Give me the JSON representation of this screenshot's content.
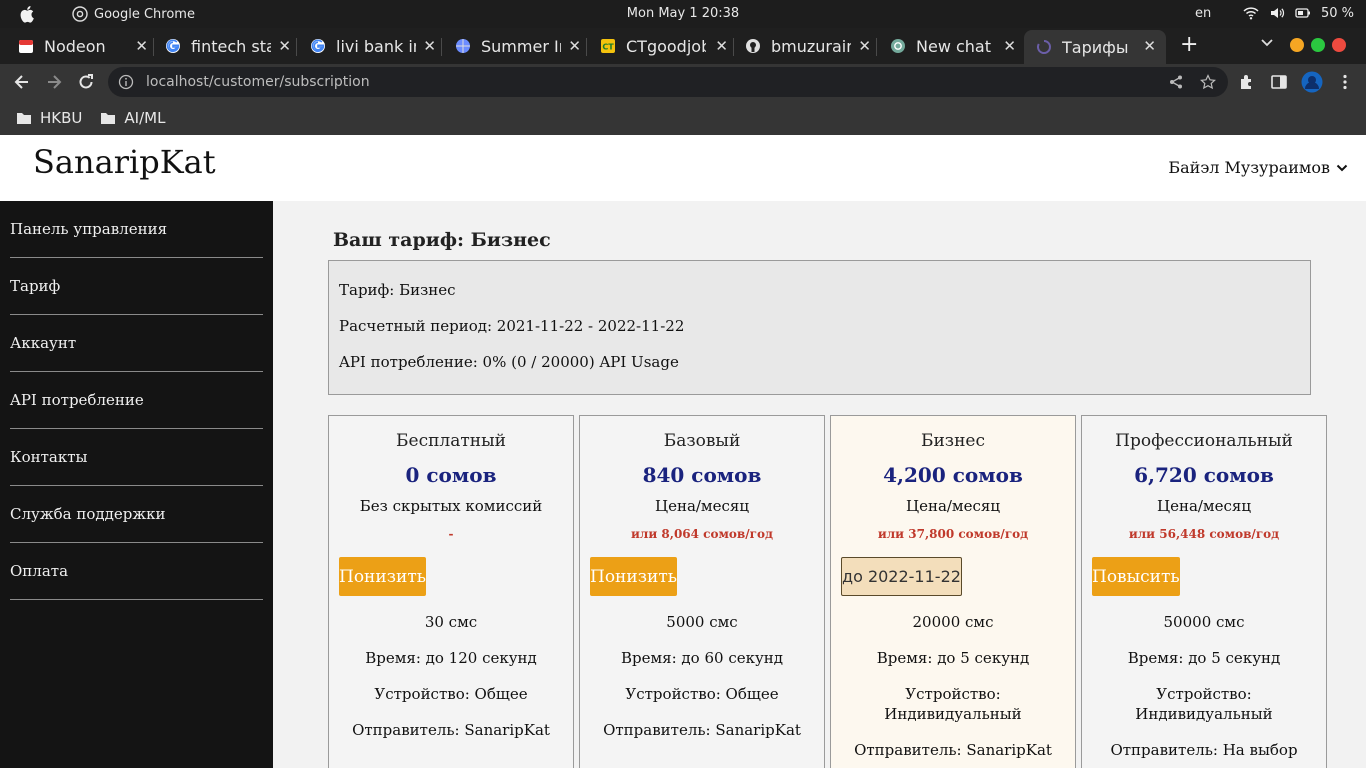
{
  "os": {
    "app_name": "Google Chrome",
    "clock": "Mon May 1  20:38",
    "lang": "en",
    "battery": "50 %"
  },
  "tabs": [
    {
      "title": "Nodeon",
      "icon": "calendar-icon",
      "color": "#e53935"
    },
    {
      "title": "fintech star",
      "icon": "google-icon",
      "color": "#4285f4"
    },
    {
      "title": "livi bank int",
      "icon": "google-icon",
      "color": "#4285f4"
    },
    {
      "title": "Summer In",
      "icon": "globe-icon",
      "color": "#6b8cff"
    },
    {
      "title": "CTgoodjobs",
      "icon": "ctgoodjobs-icon",
      "color": "#f4c20d"
    },
    {
      "title": "bmuzuraim",
      "icon": "github-icon",
      "color": "#e0e0e0"
    },
    {
      "title": "New chat",
      "icon": "chatgpt-icon",
      "color": "#74aa9c"
    },
    {
      "title": "Тарифы",
      "icon": "spinner-icon",
      "color": "#6b5ea8"
    }
  ],
  "address": {
    "url": "localhost/customer/subscription"
  },
  "bookmarks": [
    {
      "label": "HKBU"
    },
    {
      "label": "AI/ML"
    }
  ],
  "site": {
    "logo": "SanaripKat",
    "user_name": "Байэл Музураимов"
  },
  "sidebar": {
    "items": [
      {
        "label": "Панель управления"
      },
      {
        "label": "Тариф"
      },
      {
        "label": "Аккаунт"
      },
      {
        "label": "API потребление"
      },
      {
        "label": "Контакты"
      },
      {
        "label": "Служба поддержки"
      },
      {
        "label": "Оплата"
      }
    ]
  },
  "subscription": {
    "title": "Ваш тариф: Бизнес",
    "plan_line": "Тариф: Бизнес",
    "period_line": "Расчетный период: 2021-11-22 - 2022-11-22",
    "usage_line": "API потребление: 0% (0 / 20000) API Usage"
  },
  "plans": [
    {
      "name": "Бесплатный",
      "price": "0 сомов",
      "note": "Без скрытых комиссий",
      "yearly": "-",
      "button": "Понизить",
      "features": [
        "30 смс",
        "Время: до 120 секунд",
        "Устройство: Общее",
        "Отправитель: SanaripKat"
      ]
    },
    {
      "name": "Базовый",
      "price": "840 сомов",
      "note": "Цена/месяц",
      "yearly": "или 8,064 сомов/год",
      "button": "Понизить",
      "features": [
        "5000 смс",
        "Время: до 60 секунд",
        "Устройство: Общее",
        "Отправитель: SanaripKat"
      ]
    },
    {
      "name": "Бизнес",
      "price": "4,200 сомов",
      "note": "Цена/месяц",
      "yearly": "или 37,800 сомов/год",
      "button": "до 2022-11-22",
      "features": [
        "20000 смс",
        "Время: до 5 секунд",
        "Устройство: Индивидуальный",
        "Отправитель: SanaripKat"
      ]
    },
    {
      "name": "Профессиональный",
      "price": "6,720 сомов",
      "note": "Цена/месяц",
      "yearly": "или 56,448 сомов/год",
      "button": "Повысить",
      "features": [
        "50000 смс",
        "Время: до 5 секунд",
        "Устройство: Индивидуальный",
        "Отправитель: На выбор"
      ]
    }
  ],
  "colors": {
    "accent_button": "#eca016",
    "price_text": "#1a237e",
    "yearly_text": "#c0392b",
    "sidebar_bg": "#141414"
  }
}
